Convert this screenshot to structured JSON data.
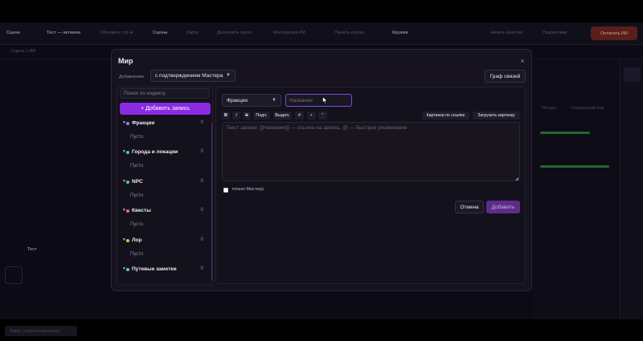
{
  "background": {
    "topbar": [
      "Сцена",
      "Тест — активна",
      "Обновить тур ⊕",
      "Сцены",
      "Карта",
      "Дополнить героя",
      "Мастерская ИИ",
      "Панель игрока",
      "Кружки",
      "Начать занятия",
      "Подписчики"
    ],
    "pay_button": "Оплатить ИИ",
    "subbar_label": "Сцена 1 ИИ",
    "right_tabs": [
      "Ротуро",
      "Следующий ход"
    ],
    "card_title": "Тест",
    "bottom_button": "Завер. откр/а в журнале(и)"
  },
  "modal": {
    "title": "Мир",
    "close_icon": "×",
    "add_mode_label": "Добавление",
    "add_mode_value": "с подтверждением Мастера",
    "graph_button": "Граф связей"
  },
  "left": {
    "search_placeholder": "Поиск по кодексу",
    "add_button": "+ Добавить запись",
    "categories": [
      {
        "name": "Фракции",
        "count": "0",
        "empty": "Пусто",
        "color": "#9b7cf0"
      },
      {
        "name": "Города и локации",
        "count": "0",
        "empty": "Пусто",
        "color": "#45c2e0"
      },
      {
        "name": "NPC",
        "count": "0",
        "empty": "Пусто",
        "color": "#3fd19c"
      },
      {
        "name": "Квесты",
        "count": "0",
        "empty": "Пусто",
        "color": "#ef6b7e"
      },
      {
        "name": "Лор",
        "count": "0",
        "empty": "Пусто",
        "color": "#f0b64a"
      },
      {
        "name": "Путевые заметки",
        "count": "0",
        "empty": "",
        "color": "#5cc9c9"
      }
    ]
  },
  "editor": {
    "category_value": "Фракции",
    "name_placeholder": "Название",
    "toolbar": [
      "B",
      "I",
      "S",
      "Подч.",
      "Выдел.",
      "#",
      "•",
      "\""
    ],
    "image_url_button": "Картинка по ссылке",
    "image_upload_button": "Загрузить картинку",
    "text_placeholder": "Текст записи. [[Название]] — ссылка на запись, @ — быстрое упоминание",
    "gm_only_label": "только Мастеру",
    "cancel_button": "Отмена",
    "submit_button": "Добавить"
  },
  "colors": {
    "accent": "#8a2be2",
    "submit_disabled": "#5d2c8a"
  }
}
